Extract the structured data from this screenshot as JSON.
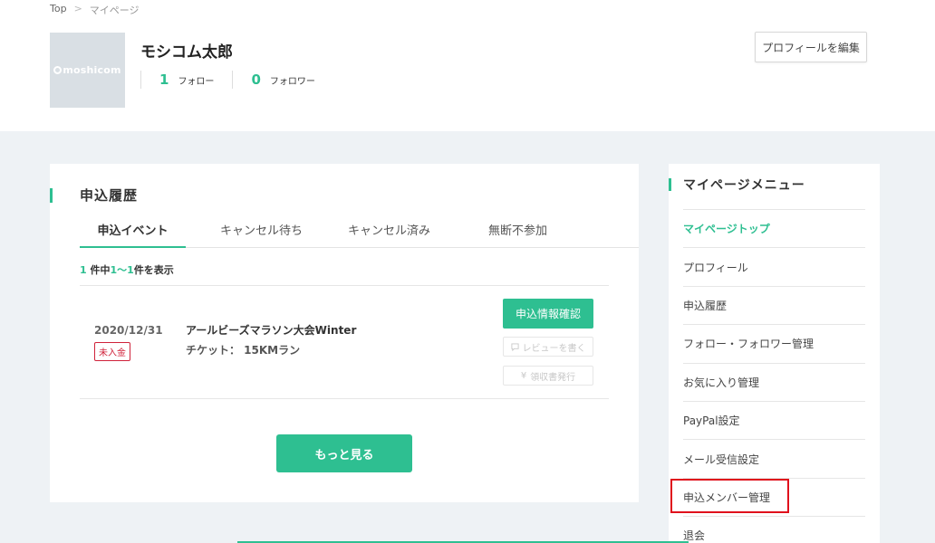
{
  "breadcrumb": {
    "home": "Top",
    "separator": ">",
    "current": "マイページ"
  },
  "profile": {
    "avatar_text": "moshicom",
    "name": "モシコム太郎",
    "follow_count": "1",
    "follow_label": "フォロー",
    "follower_count": "0",
    "follower_label": "フォロワー",
    "edit_button": "プロフィールを編集"
  },
  "history": {
    "title": "申込履歴",
    "tabs": [
      {
        "label": "申込イベント"
      },
      {
        "label": "キャンセル待ち"
      },
      {
        "label": "キャンセル済み"
      },
      {
        "label": "無断不参加"
      }
    ],
    "result": {
      "total": "1",
      "mid1": " 件中",
      "range": "1〜1",
      "mid2": "件を表示"
    },
    "entries": [
      {
        "date": "2020/12/31",
        "status": "未入金",
        "event_name": "アールビーズマラソン大会Winter",
        "ticket": "チケット： 15KMラン",
        "confirm_button": "申込情報確認",
        "review_button": "レビューを書く",
        "receipt_button": "領収書発行"
      }
    ],
    "more_button": "もっと見る"
  },
  "sidebar": {
    "title": "マイページメニュー",
    "items": [
      {
        "label": "マイページトップ"
      },
      {
        "label": "プロフィール"
      },
      {
        "label": "申込履歴"
      },
      {
        "label": "フォロー・フォロワー管理"
      },
      {
        "label": "お気に入り管理"
      },
      {
        "label": "PayPal設定"
      },
      {
        "label": "メール受信設定"
      },
      {
        "label": "申込メンバー管理"
      },
      {
        "label": "退会"
      }
    ]
  },
  "colors": {
    "accent": "#2ebf91",
    "alert": "#d0223a",
    "highlight": "#e0101c"
  }
}
